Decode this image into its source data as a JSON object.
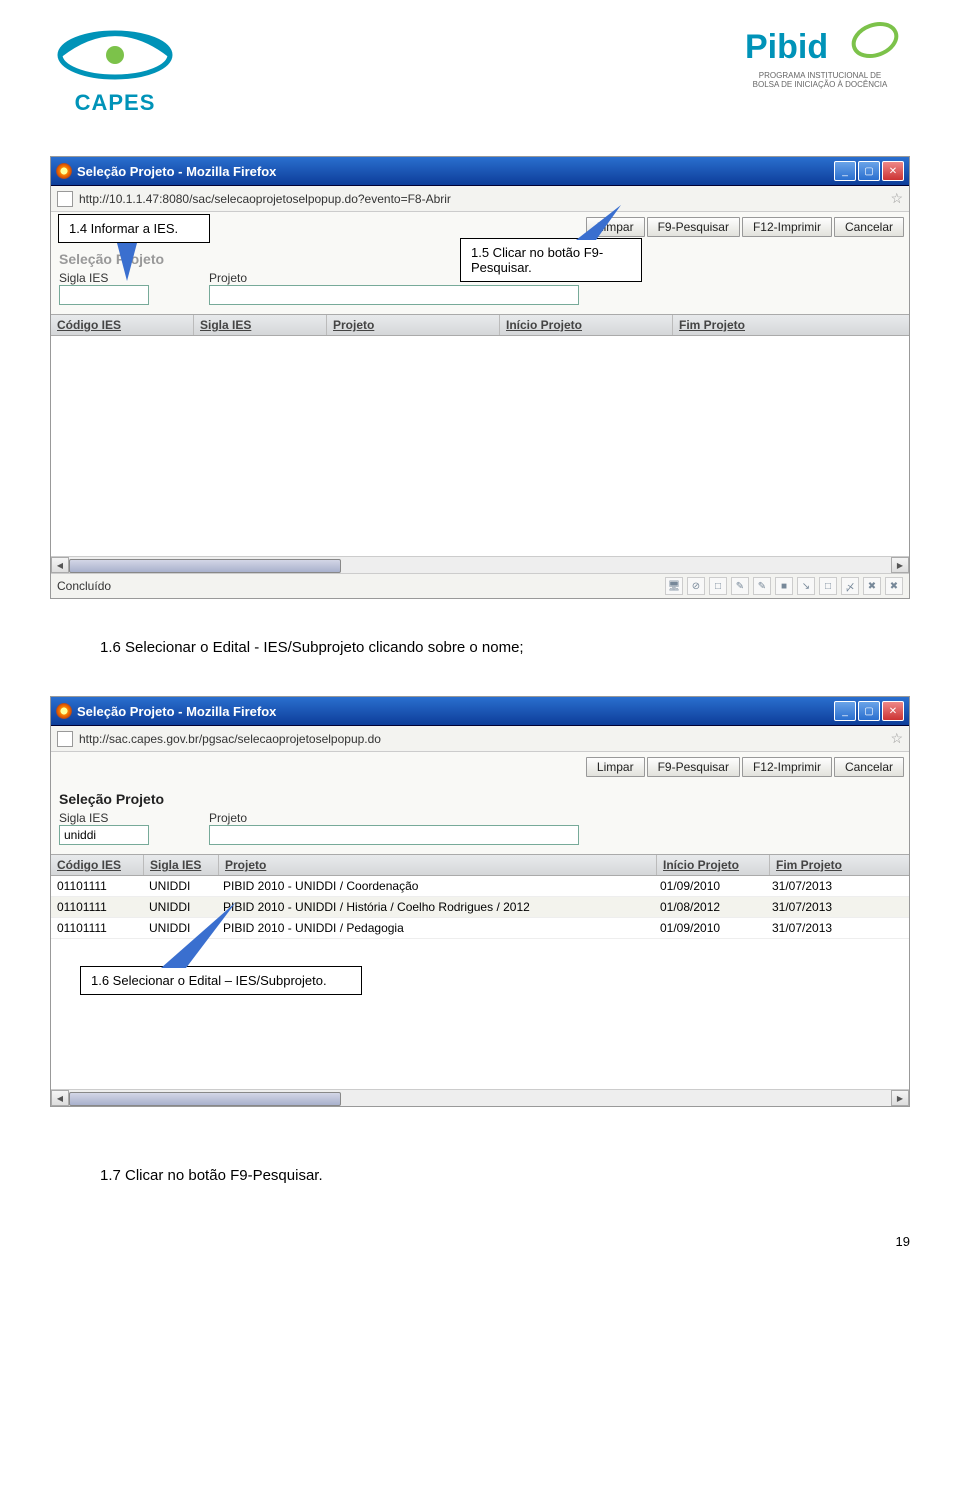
{
  "logos": {
    "capes_text": "CAPES",
    "pibid_text": "Pibid",
    "pibid_sub1": "PROGRAMA INSTITUCIONAL DE",
    "pibid_sub2": "BOLSA DE INICIAÇÃO À DOCÊNCIA"
  },
  "callouts": {
    "c14": "1.4 Informar a IES.",
    "c15a": "1.5 Clicar no botão F9-",
    "c15b": "Pesquisar.",
    "c16b": "1.6 Selecionar o Edital – IES/Subprojeto."
  },
  "body": {
    "t16": "1.6 Selecionar o Edital - IES/Subprojeto clicando sobre o nome;",
    "t17": "1.7 Clicar no botão F9-Pesquisar."
  },
  "win1": {
    "title": "Seleção Projeto - Mozilla Firefox",
    "url": "http://10.1.1.47:8080/sac/selecaoprojetoselpopup.do?evento=F8-Abrir",
    "btn_limpar": "Limpar",
    "btn_f9": "F9-Pesquisar",
    "btn_f12": "F12-Imprimir",
    "btn_cancelar": "Cancelar",
    "section": "Seleção Projeto",
    "lbl_sigla": "Sigla IES",
    "lbl_projeto": "Projeto",
    "val_sigla": "",
    "val_projeto": "",
    "cols": {
      "c1": "Código IES",
      "c2": "Sigla IES",
      "c3": "Projeto",
      "c4": "Início Projeto",
      "c5": "Fim Projeto"
    },
    "status": "Concluído"
  },
  "win2": {
    "title": "Seleção Projeto - Mozilla Firefox",
    "url": "http://sac.capes.gov.br/pgsac/selecaoprojetoselpopup.do",
    "btn_limpar": "Limpar",
    "btn_f9": "F9-Pesquisar",
    "btn_f12": "F12-Imprimir",
    "btn_cancelar": "Cancelar",
    "section": "Seleção Projeto",
    "lbl_sigla": "Sigla IES",
    "lbl_projeto": "Projeto",
    "val_sigla": "uniddi",
    "val_projeto": "",
    "cols": {
      "c1": "Código IES",
      "c2": "Sigla IES",
      "c3": "Projeto",
      "c4": "Início Projeto",
      "c5": "Fim Projeto"
    },
    "rows": [
      {
        "cod": "01101111",
        "sigla": "UNIDDI",
        "proj": "PIBID 2010 - UNIDDI / Coordenação",
        "ini": "01/09/2010",
        "fim": "31/07/2013"
      },
      {
        "cod": "01101111",
        "sigla": "UNIDDI",
        "proj": "PIBID 2010 - UNIDDI / História / Coelho Rodrigues / 2012",
        "ini": "01/08/2012",
        "fim": "31/07/2013"
      },
      {
        "cod": "01101111",
        "sigla": "UNIDDI",
        "proj": "PIBID 2010 - UNIDDI / Pedagogia",
        "ini": "01/09/2010",
        "fim": "31/07/2013"
      }
    ]
  },
  "page_number": "19"
}
